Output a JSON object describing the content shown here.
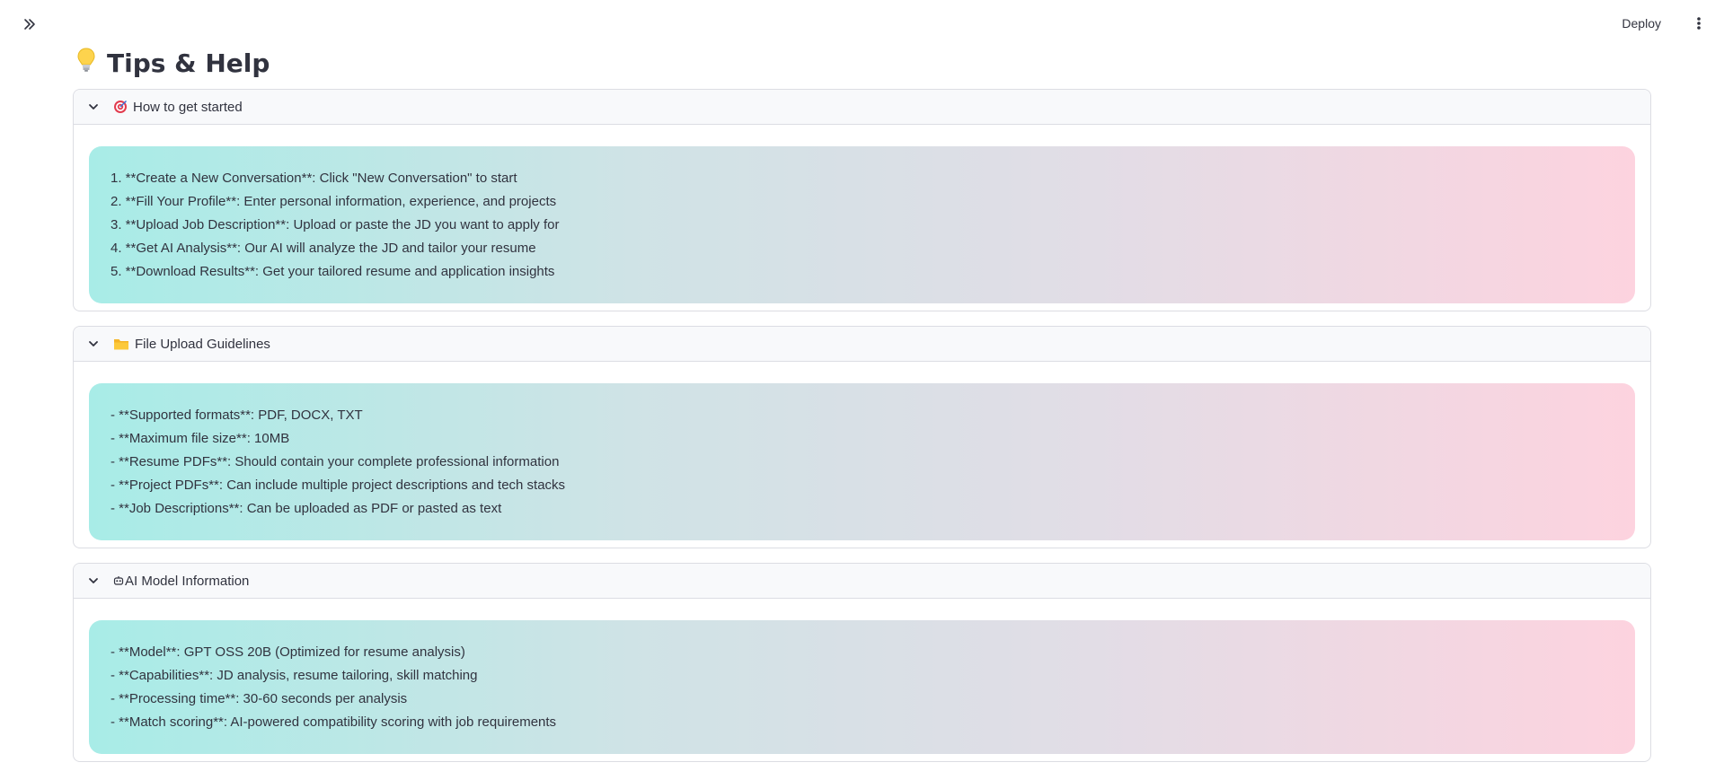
{
  "header": {
    "deploy_label": "Deploy"
  },
  "page": {
    "title": "Tips & Help",
    "title_icon": "lightbulb-icon"
  },
  "sections": [
    {
      "title": "How to get started",
      "icon": "target-icon",
      "lines": [
        "1. **Create a New Conversation**: Click \"New Conversation\" to start",
        "2. **Fill Your Profile**: Enter personal information, experience, and projects",
        "3. **Upload Job Description**: Upload or paste the JD you want to apply for",
        "4. **Get AI Analysis**: Our AI will analyze the JD and tailor your resume",
        "5. **Download Results**: Get your tailored resume and application insights"
      ]
    },
    {
      "title": "File Upload Guidelines",
      "icon": "folder-icon",
      "lines": [
        "- **Supported formats**: PDF, DOCX, TXT",
        "- **Maximum file size**: 10MB",
        "- **Resume PDFs**: Should contain your complete professional information",
        "- **Project PDFs**: Can include multiple project descriptions and tech stacks",
        "- **Job Descriptions**: Can be uploaded as PDF or pasted as text"
      ]
    },
    {
      "title": "AI Model Information",
      "icon": "robot-icon",
      "lines": [
        "- **Model**: GPT OSS 20B (Optimized for resume analysis)",
        "- **Capabilities**: JD analysis, resume tailoring, skill matching",
        "- **Processing time**: 30-60 seconds per analysis",
        "- **Match scoring**: AI-powered compatibility scoring with job requirements"
      ]
    }
  ],
  "colors": {
    "gradient_start": "#a8ece7",
    "gradient_end": "#fdd3df",
    "text": "#31333f",
    "border": "#dcdde3"
  }
}
